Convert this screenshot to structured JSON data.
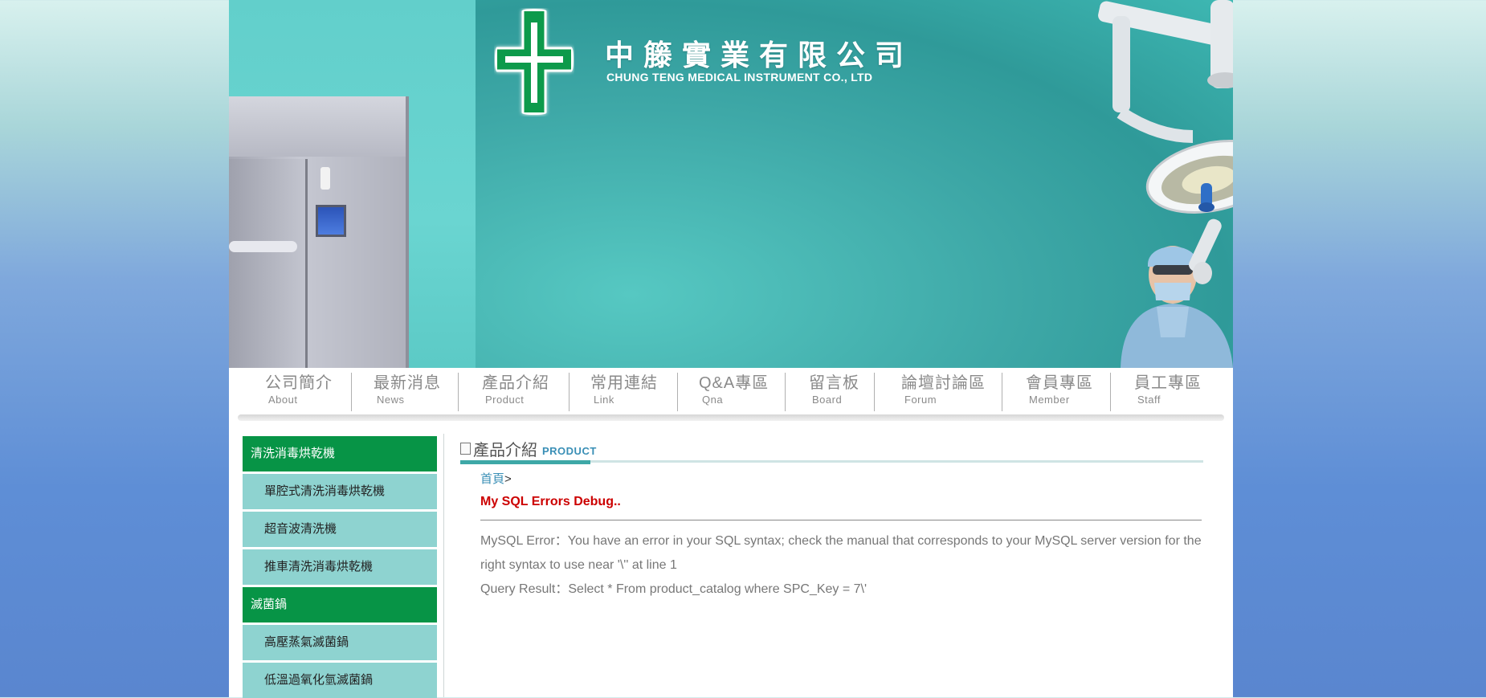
{
  "header": {
    "company_zh": "中籐實業有限公司",
    "company_en": "CHUNG TENG MEDICAL INSTRUMENT CO., LTD"
  },
  "nav": [
    {
      "zh": "公司簡介",
      "en": "About"
    },
    {
      "zh": "最新消息",
      "en": "News"
    },
    {
      "zh": "產品介紹",
      "en": "Product"
    },
    {
      "zh": "常用連結",
      "en": "Link"
    },
    {
      "zh": "Q&A專區",
      "en": "Qna"
    },
    {
      "zh": "留言板",
      "en": "Board"
    },
    {
      "zh": "論壇討論區",
      "en": "Forum"
    },
    {
      "zh": "會員專區",
      "en": "Member"
    },
    {
      "zh": "員工專區",
      "en": "Staff"
    }
  ],
  "sidebar": {
    "groups": [
      {
        "category": "清洗消毒烘乾機",
        "items": [
          "單腔式清洗消毒烘乾機",
          "超音波清洗機",
          "推車清洗消毒烘乾機"
        ]
      },
      {
        "category": "滅菌鍋",
        "items": [
          "高壓蒸氣滅菌鍋",
          "低溫過氧化氫滅菌鍋"
        ]
      }
    ]
  },
  "main": {
    "section_zh": "產品介紹",
    "section_en": "PRODUCT",
    "breadcrumb_home": "首頁",
    "breadcrumb_sep": ">",
    "error_title": "My SQL Errors Debug..",
    "error_line1": "MySQL Error：You have an error in your SQL syntax; check the manual that corresponds to your MySQL server version for the right syntax to use near '\\'' at line 1",
    "error_line2": "Query Result：Select * From product_catalog where SPC_Key = 7\\'"
  },
  "colors": {
    "accent_green": "#079446",
    "teal": "#3ea8a7",
    "sidebar_item_bg": "#8ed3d0",
    "error_red": "#cc0000"
  }
}
